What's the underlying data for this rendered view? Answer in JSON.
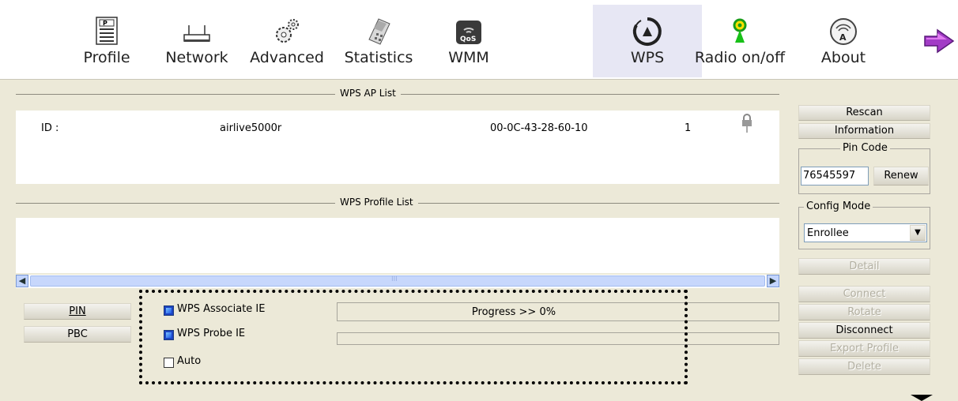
{
  "toolbar": {
    "items": [
      {
        "label": "Profile",
        "icon": "profile-icon"
      },
      {
        "label": "Network",
        "icon": "network-icon"
      },
      {
        "label": "Advanced",
        "icon": "gears-icon"
      },
      {
        "label": "Statistics",
        "icon": "calculator-icon"
      },
      {
        "label": "WMM",
        "icon": "qos-icon"
      },
      {
        "label": "WPS",
        "icon": "wps-icon"
      },
      {
        "label": "Radio on/off",
        "icon": "radio-icon"
      },
      {
        "label": "About",
        "icon": "about-icon"
      }
    ],
    "active": "WPS",
    "next_icon": "arrow-right-icon"
  },
  "ap_list": {
    "title": "WPS AP List",
    "rows": [
      {
        "id": "ID :",
        "ssid": "airlive5000r",
        "bssid": "00-0C-43-28-60-10",
        "channel": "1",
        "icon": "lock-icon"
      }
    ]
  },
  "profile_list": {
    "title": "WPS Profile List",
    "scroll_thumb_label": "III"
  },
  "buttons": {
    "pin": "PIN",
    "pbc": "PBC"
  },
  "options": {
    "associate_ie": {
      "label": "WPS Associate IE",
      "checked": true
    },
    "probe_ie": {
      "label": "WPS Probe IE",
      "checked": true
    },
    "auto": {
      "label": "Auto",
      "checked": false
    }
  },
  "progress": {
    "text": "Progress >> 0%",
    "value": 0
  },
  "side": {
    "rescan": "Rescan",
    "information": "Information",
    "pin_code_title": "Pin Code",
    "pin_code": "76545597",
    "renew": "Renew",
    "config_mode_title": "Config Mode",
    "config_mode": "Enrollee",
    "detail": "Detail",
    "connect": "Connect",
    "rotate": "Rotate",
    "disconnect": "Disconnect",
    "export_profile": "Export Profile",
    "delete": "Delete"
  },
  "colors": {
    "accent": "#1c43c2",
    "background": "#ece9d8",
    "highlight_border": "#000000"
  }
}
